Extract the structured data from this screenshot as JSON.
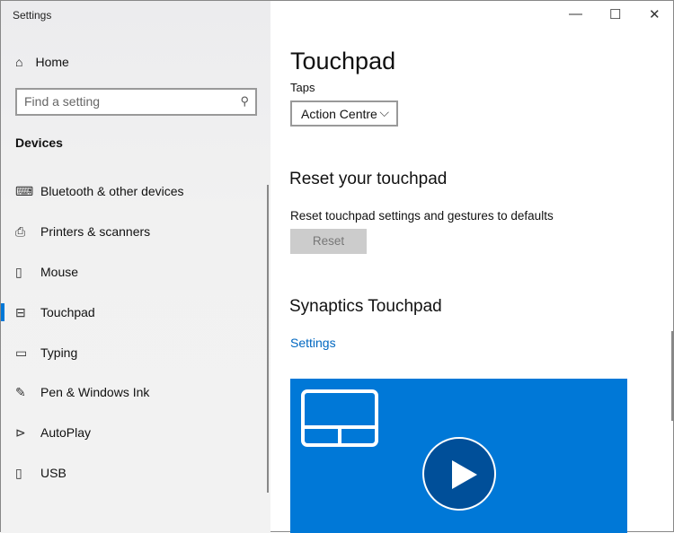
{
  "window": {
    "title": "Settings"
  },
  "sidebar": {
    "home": "Home",
    "search_placeholder": "Find a setting",
    "section": "Devices",
    "items": [
      {
        "label": "Bluetooth & other devices",
        "icon": "bluetooth-devices-icon"
      },
      {
        "label": "Printers & scanners",
        "icon": "printer-icon"
      },
      {
        "label": "Mouse",
        "icon": "mouse-icon"
      },
      {
        "label": "Touchpad",
        "icon": "touchpad-icon"
      },
      {
        "label": "Typing",
        "icon": "keyboard-icon"
      },
      {
        "label": "Pen & Windows Ink",
        "icon": "pen-icon"
      },
      {
        "label": "AutoPlay",
        "icon": "autoplay-icon"
      },
      {
        "label": "USB",
        "icon": "usb-icon"
      }
    ]
  },
  "main": {
    "title": "Touchpad",
    "taps_label": "Taps",
    "taps_value": "Action Centre",
    "reset_heading": "Reset your touchpad",
    "reset_desc": "Reset touchpad settings and gestures to defaults",
    "reset_button": "Reset",
    "synaptics_heading": "Synaptics Touchpad",
    "settings_link": "Settings"
  },
  "colors": {
    "accent": "#0078d7"
  }
}
